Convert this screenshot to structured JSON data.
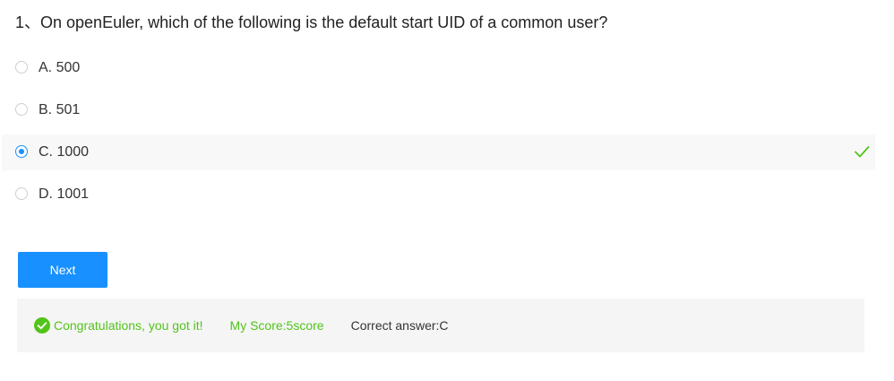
{
  "question": {
    "text": "1、On openEuler, which of the following is the default start UID of a common user?"
  },
  "options": [
    {
      "label": "A. 500",
      "selected": false
    },
    {
      "label": "B. 501",
      "selected": false
    },
    {
      "label": "C. 1000",
      "selected": true
    },
    {
      "label": "D. 1001",
      "selected": false
    }
  ],
  "next_button": {
    "label": "Next"
  },
  "result": {
    "message": "Congratulations, you got it!",
    "score": "My Score:5score",
    "correct_answer": "Correct answer:C"
  },
  "icons": {
    "check": "check-icon",
    "success": "check-circle-icon"
  },
  "colors": {
    "accent": "#1890ff",
    "success": "#52c41a",
    "panel": "#f5f5f5"
  }
}
